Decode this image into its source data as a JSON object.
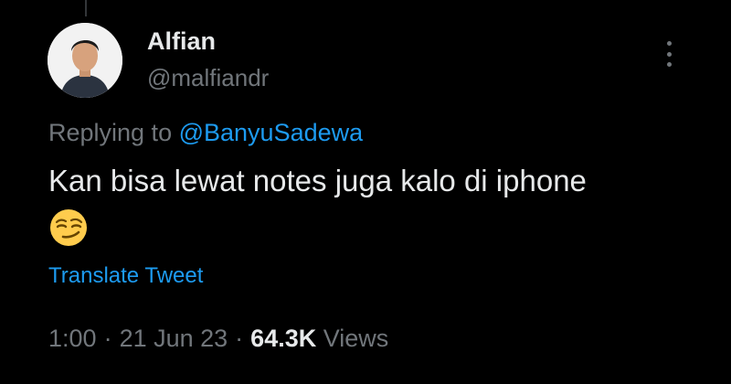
{
  "colors": {
    "background": "#000000",
    "primary_text": "#e7e9ea",
    "secondary_text": "#71767b",
    "link": "#1d9bf0"
  },
  "tweet": {
    "author": {
      "display_name": "Alfian",
      "handle": "@malfiandr",
      "avatar_icon": "profile-photo"
    },
    "more_icon": "more-vertical-icon",
    "replying_to_prefix": "Replying to",
    "replying_to_handle": "@BanyuSadewa",
    "text": "Kan bisa lewat notes juga kalo di iphone",
    "emoji": "😏",
    "translate_label": "Translate Tweet",
    "time": "1:00",
    "separator": "·",
    "date": "21 Jun 23",
    "views_count": "64.3K",
    "views_label": "Views"
  }
}
